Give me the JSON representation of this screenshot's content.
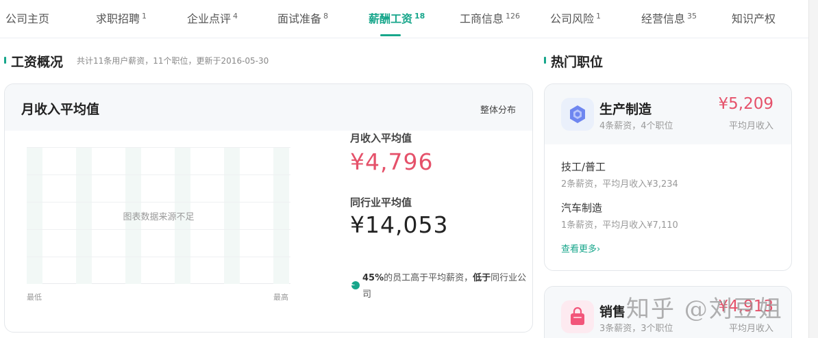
{
  "tabs": [
    {
      "label": "公司主页",
      "count": ""
    },
    {
      "label": "求职招聘",
      "count": "1"
    },
    {
      "label": "企业点评",
      "count": "4"
    },
    {
      "label": "面试准备",
      "count": "8"
    },
    {
      "label": "薪酬工资",
      "count": "18"
    },
    {
      "label": "工商信息",
      "count": "126"
    },
    {
      "label": "公司风险",
      "count": "1"
    },
    {
      "label": "经营信息",
      "count": "35"
    },
    {
      "label": "知识产权",
      "count": ""
    }
  ],
  "active_tab": "薪酬工资",
  "salary_section": {
    "title": "工资概况",
    "subtitle": "共计11条用户薪资，11个职位，更新于2016-05-30"
  },
  "salary_card": {
    "title": "月收入平均值",
    "distribution_link": "整体分布",
    "chart_empty_text": "图表数据来源不足",
    "axis_low": "最低",
    "axis_high": "最高",
    "avg_label": "月收入平均值",
    "avg_value": "¥4,796",
    "industry_label": "同行业平均值",
    "industry_value": "¥14,053",
    "note_percent": "45%",
    "note_text_1": "的员工高于平均薪资，",
    "note_bold": "低于",
    "note_text_2": "同行业公司"
  },
  "hot_section": {
    "title": "热门职位"
  },
  "job_cards": [
    {
      "name": "生产制造",
      "meta": "4条薪资，4个职位",
      "salary": "¥5,209",
      "salary_label": "平均月收入",
      "icon": "hexagon-icon",
      "sub_jobs": [
        {
          "name": "技工/普工",
          "meta": "2条薪资，平均月收入¥3,234"
        },
        {
          "name": "汽车制造",
          "meta": "1条薪资，平均月收入¥7,110"
        }
      ],
      "more_label": "查看更多›"
    },
    {
      "name": "销售",
      "meta": "3条薪资，3个职位",
      "salary": "¥4,913",
      "salary_label": "平均月收入",
      "icon": "shopping-bag-icon"
    }
  ],
  "watermark": "知乎 @刘豆姐",
  "colors": {
    "accent": "#17a68b",
    "price": "#e5516a"
  }
}
